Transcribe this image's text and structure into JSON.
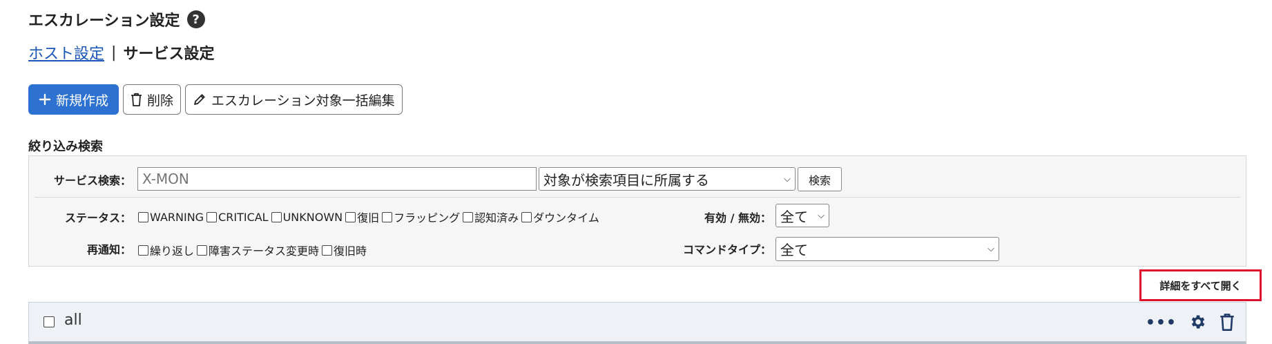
{
  "page": {
    "title": "エスカレーション設定",
    "help": "?"
  },
  "subnav": {
    "host": "ホスト設定",
    "separator": "|",
    "service": "サービス設定"
  },
  "toolbar": {
    "new_label": "新規作成",
    "delete_label": "削除",
    "bulk_edit_label": "エスカレーション対象一括編集"
  },
  "filter": {
    "title": "絞り込み検索",
    "service_search_label": "サービス検索：",
    "service_search_placeholder": "X-MON",
    "scope_selected": "対象が検索項目に所属する",
    "search_button": "検索",
    "status_label": "ステータス：",
    "status_options": [
      "WARNING",
      "CRITICAL",
      "UNKNOWN",
      "復旧",
      "フラッピング",
      "認知済み",
      "ダウンタイム"
    ],
    "enabled_label": "有効 / 無効：",
    "enabled_selected": "全て",
    "renotify_label": "再通知：",
    "renotify_options": [
      "繰り返し",
      "障害ステータス変更時",
      "復旧時"
    ],
    "command_type_label": "コマンドタイプ：",
    "command_type_selected": "全て"
  },
  "expand_all": "詳細をすべて開く",
  "group": {
    "name": "all"
  },
  "colors": {
    "primary": "#2d71d1",
    "highlight": "#e0102a",
    "icon": "#1f3a66"
  }
}
